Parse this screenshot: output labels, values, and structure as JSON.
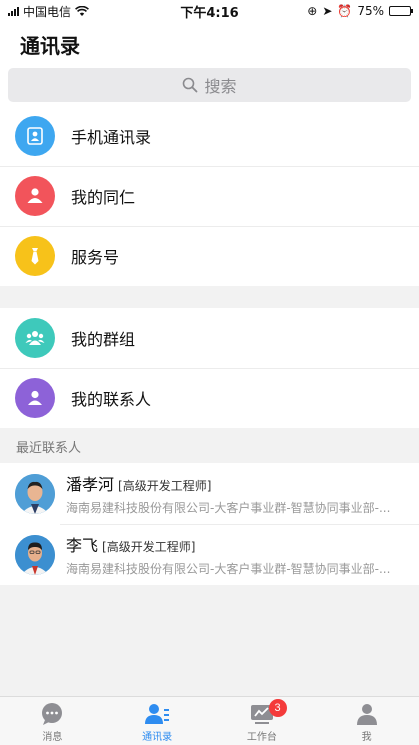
{
  "status_bar": {
    "carrier": "中国电信",
    "time": "下午4:16",
    "battery": "75%",
    "battery_level": 0.75
  },
  "header": {
    "title": "通讯录"
  },
  "search": {
    "placeholder": "搜索"
  },
  "menu_group_1": [
    {
      "label": "手机通讯录",
      "icon": "phone-contacts-icon",
      "color": "#3ea7f0"
    },
    {
      "label": "我的同仁",
      "icon": "colleague-icon",
      "color": "#f2545b"
    },
    {
      "label": "服务号",
      "icon": "service-tie-icon",
      "color": "#f7c21a"
    }
  ],
  "menu_group_2": [
    {
      "label": "我的群组",
      "icon": "group-icon",
      "color": "#3ec9bb"
    },
    {
      "label": "我的联系人",
      "icon": "contact-person-icon",
      "color": "#8d62d8"
    }
  ],
  "recent": {
    "section_title": "最近联系人",
    "contacts": [
      {
        "name": "潘孝河",
        "title": "[高级开发工程师]",
        "org": "海南易建科技股份有限公司-大客户事业群-智慧协同事业部-..."
      },
      {
        "name": "李飞",
        "title": "[高级开发工程师]",
        "org": "海南易建科技股份有限公司-大客户事业群-智慧协同事业部-..."
      }
    ]
  },
  "tabs": [
    {
      "label": "消息",
      "icon": "message-icon",
      "active": false
    },
    {
      "label": "通讯录",
      "icon": "contacts-icon",
      "active": true
    },
    {
      "label": "工作台",
      "icon": "workbench-icon",
      "active": false,
      "badge": "3"
    },
    {
      "label": "我",
      "icon": "profile-icon",
      "active": false
    }
  ],
  "colors": {
    "accent": "#2e8cf0",
    "badge": "#f43b3b"
  }
}
